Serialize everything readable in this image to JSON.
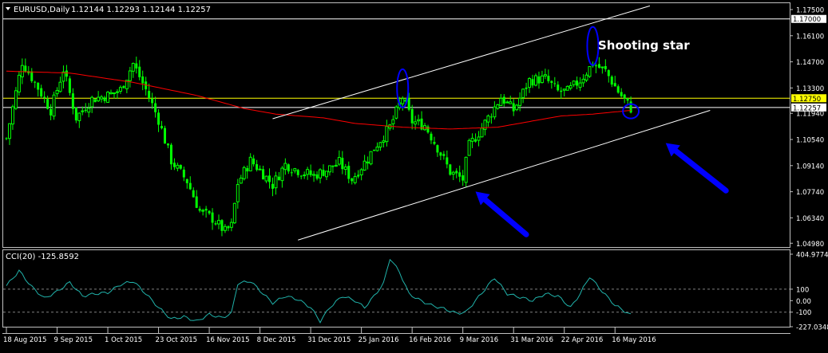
{
  "window": {
    "symbol_label": "EURUSD,Daily",
    "ohlc_label": "1.12144 1.12293 1.12144 1.12257",
    "menu_icon": "triangle-down-icon"
  },
  "colors": {
    "background": "#000000",
    "frame": "#c0c0c0",
    "bull": "#00ff00",
    "bear": "#00ff00",
    "ma": "#ff0000",
    "channel": "#ffffff",
    "cci": "#20b2aa",
    "highlight_line": "#ffff00",
    "annotation": "#0000ff",
    "text": "#ffffff",
    "price_tag_bg": "#ffff00",
    "price_tag_text": "#000000"
  },
  "annotations": {
    "pattern_label": "Shooting star"
  },
  "chart_data": [
    {
      "type": "candlestick",
      "title": "EURUSD,Daily",
      "ylim": [
        1.0482,
        1.178
      ],
      "y_ticks": [
        "1.17500",
        "1.16100",
        "1.14700",
        "1.13300",
        "1.11940",
        "1.10540",
        "1.09140",
        "1.07740",
        "1.06340",
        "1.04980"
      ],
      "y_tick_values": [
        1.175,
        1.161,
        1.147,
        1.133,
        1.1194,
        1.1054,
        1.0914,
        1.0774,
        1.0634,
        1.0498
      ],
      "x_ticks": [
        "18 Aug 2015",
        "9 Sep 2015",
        "1 Oct 2015",
        "23 Oct 2015",
        "16 Nov 2015",
        "8 Dec 2015",
        "31 Dec 2015",
        "25 Jan 2016",
        "16 Feb 2016",
        "9 Mar 2016",
        "31 Mar 2016",
        "22 Apr 2016",
        "16 May 2016"
      ],
      "x_tick_bars": [
        0,
        16,
        32,
        48,
        64,
        80,
        96,
        112,
        128,
        144,
        160,
        176,
        192
      ],
      "price_levels": [
        {
          "label": "1.17000",
          "value": 1.17
        },
        {
          "label": "1.12750",
          "value": 1.1275
        },
        {
          "label": "1.12257",
          "value": 1.12257
        }
      ],
      "anchors": [
        [
          0,
          1.106
        ],
        [
          5,
          1.147
        ],
        [
          10,
          1.133
        ],
        [
          14,
          1.121
        ],
        [
          18,
          1.143
        ],
        [
          22,
          1.117
        ],
        [
          27,
          1.127
        ],
        [
          32,
          1.129
        ],
        [
          36,
          1.132
        ],
        [
          40,
          1.146
        ],
        [
          44,
          1.132
        ],
        [
          48,
          1.116
        ],
        [
          52,
          1.094
        ],
        [
          57,
          1.083
        ],
        [
          61,
          1.067
        ],
        [
          65,
          1.063
        ],
        [
          69,
          1.056
        ],
        [
          71,
          1.059
        ],
        [
          73,
          1.082
        ],
        [
          77,
          1.094
        ],
        [
          80,
          1.089
        ],
        [
          84,
          1.081
        ],
        [
          88,
          1.092
        ],
        [
          93,
          1.088
        ],
        [
          97,
          1.086
        ],
        [
          101,
          1.089
        ],
        [
          105,
          1.093
        ],
        [
          109,
          1.084
        ],
        [
          113,
          1.093
        ],
        [
          117,
          1.103
        ],
        [
          121,
          1.112
        ],
        [
          125,
          1.128
        ],
        [
          128,
          1.115
        ],
        [
          132,
          1.113
        ],
        [
          136,
          1.101
        ],
        [
          140,
          1.088
        ],
        [
          144,
          1.084
        ],
        [
          146,
          1.102
        ],
        [
          149,
          1.109
        ],
        [
          152,
          1.117
        ],
        [
          156,
          1.128
        ],
        [
          160,
          1.121
        ],
        [
          165,
          1.137
        ],
        [
          170,
          1.138
        ],
        [
          174,
          1.131
        ],
        [
          177,
          1.131
        ],
        [
          181,
          1.137
        ],
        [
          185,
          1.146
        ],
        [
          189,
          1.142
        ],
        [
          193,
          1.131
        ],
        [
          197,
          1.122
        ]
      ],
      "ma_anchors": [
        [
          0,
          1.142
        ],
        [
          20,
          1.141
        ],
        [
          40,
          1.136
        ],
        [
          60,
          1.129
        ],
        [
          75,
          1.122
        ],
        [
          85,
          1.119
        ],
        [
          100,
          1.117
        ],
        [
          110,
          1.114
        ],
        [
          125,
          1.112
        ],
        [
          140,
          1.111
        ],
        [
          155,
          1.112
        ],
        [
          165,
          1.115
        ],
        [
          175,
          1.118
        ],
        [
          185,
          1.119
        ],
        [
          197,
          1.121
        ]
      ],
      "upper_channel": [
        [
          84,
          1.1165
        ],
        [
          203,
          1.177
        ]
      ],
      "lower_channel": [
        [
          92,
          1.0515
        ],
        [
          222,
          1.121
        ]
      ],
      "pattern_ellipses": [
        {
          "bar": 125,
          "price": 1.1328
        },
        {
          "bar": 185,
          "price": 1.1555
        },
        {
          "bar": 197,
          "price": 1.1205
        }
      ],
      "arrows": [
        {
          "from_bar": 164,
          "from_price": 1.0545,
          "to_bar": 148,
          "to_price": 1.0775
        },
        {
          "from_bar": 227,
          "from_price": 1.078,
          "to_bar": 208,
          "to_price": 1.1035
        }
      ],
      "bar_count": 198
    },
    {
      "type": "line",
      "title": "CCI(20) -125.8592",
      "ylim": [
        -227.0348,
        404.9774
      ],
      "y_ticks": [
        "404.9774",
        "100",
        "0.00",
        "-100",
        "-227.0348"
      ],
      "y_tick_values": [
        404.9774,
        100,
        0,
        -100,
        -227.0348
      ],
      "levels": [
        100,
        -100
      ],
      "anchors": [
        [
          0,
          130
        ],
        [
          4,
          260
        ],
        [
          8,
          120
        ],
        [
          12,
          20
        ],
        [
          16,
          80
        ],
        [
          20,
          160
        ],
        [
          24,
          40
        ],
        [
          28,
          60
        ],
        [
          32,
          70
        ],
        [
          36,
          140
        ],
        [
          40,
          170
        ],
        [
          44,
          60
        ],
        [
          48,
          -60
        ],
        [
          52,
          -160
        ],
        [
          56,
          -140
        ],
        [
          60,
          -180
        ],
        [
          64,
          -120
        ],
        [
          68,
          -150
        ],
        [
          71,
          -110
        ],
        [
          73,
          150
        ],
        [
          77,
          170
        ],
        [
          81,
          60
        ],
        [
          84,
          -20
        ],
        [
          88,
          40
        ],
        [
          92,
          10
        ],
        [
          96,
          -60
        ],
        [
          99,
          -180
        ],
        [
          102,
          -60
        ],
        [
          106,
          40
        ],
        [
          110,
          0
        ],
        [
          113,
          -60
        ],
        [
          116,
          40
        ],
        [
          119,
          150
        ],
        [
          121,
          370
        ],
        [
          124,
          250
        ],
        [
          127,
          60
        ],
        [
          130,
          10
        ],
        [
          134,
          -40
        ],
        [
          138,
          -70
        ],
        [
          142,
          -110
        ],
        [
          145,
          -100
        ],
        [
          148,
          0
        ],
        [
          151,
          100
        ],
        [
          154,
          200
        ],
        [
          158,
          60
        ],
        [
          162,
          30
        ],
        [
          166,
          0
        ],
        [
          170,
          60
        ],
        [
          174,
          40
        ],
        [
          178,
          -60
        ],
        [
          181,
          60
        ],
        [
          184,
          210
        ],
        [
          188,
          80
        ],
        [
          192,
          -40
        ],
        [
          197,
          -125.86
        ]
      ]
    }
  ]
}
